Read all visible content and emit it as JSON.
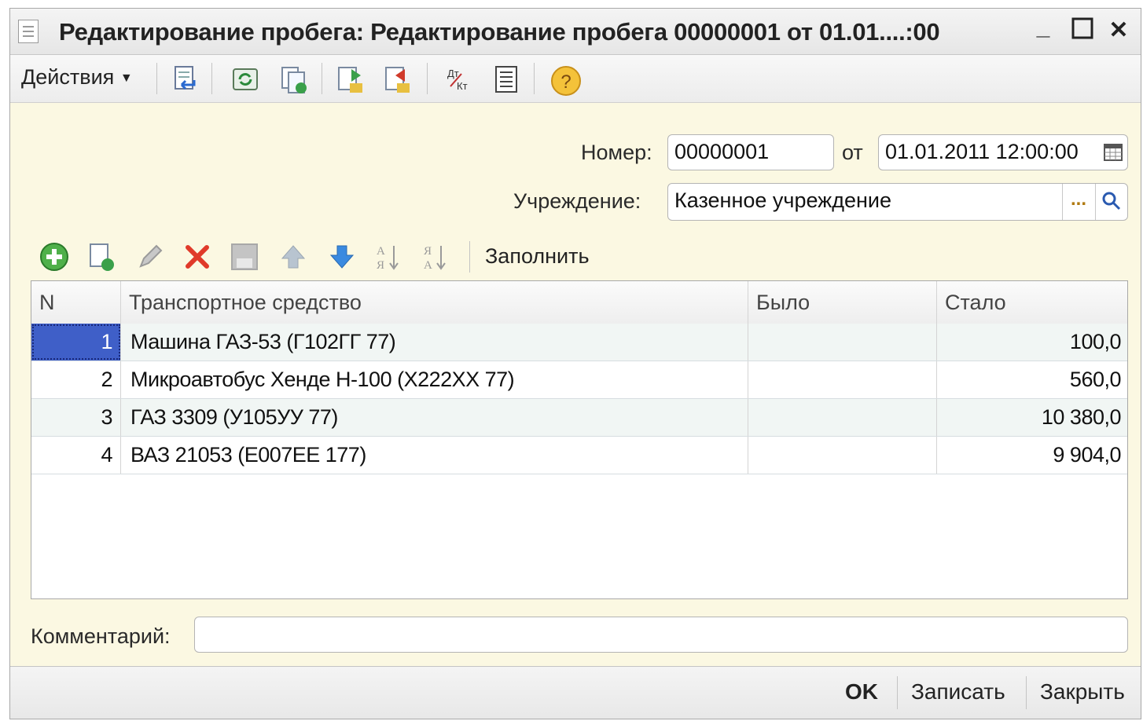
{
  "window": {
    "title": "Редактирование пробега: Редактирование пробега 00000001 от 01.01....:00",
    "minimize_glyph": "_",
    "maximize_glyph": "☐",
    "close_glyph": "✕"
  },
  "toolbar": {
    "actions_label": "Действия",
    "icons": [
      "post-and-close-icon",
      "refresh-icon",
      "copy-document-icon",
      "post-icon",
      "unpost-icon",
      "debit-credit-icon",
      "report-icon",
      "help-icon"
    ]
  },
  "form": {
    "number_label": "Номер:",
    "number_value": "00000001",
    "date_label": "от",
    "date_value": "01.01.2011 12:00:00",
    "institution_label": "Учреждение:",
    "institution_value": "Казенное учреждение",
    "comment_label": "Комментарий:",
    "comment_value": ""
  },
  "table_toolbar": {
    "fill_label": "Заполнить"
  },
  "table": {
    "columns": [
      "N",
      "Транспортное средство",
      "Было",
      "Стало"
    ],
    "rows": [
      {
        "n": "1",
        "vehicle": "Машина ГАЗ-53 (Г102ГГ 77)",
        "was": "",
        "became": "100,0"
      },
      {
        "n": "2",
        "vehicle": "Микроавтобус Хенде Н-100 (Х222ХХ 77)",
        "was": "",
        "became": "560,0"
      },
      {
        "n": "3",
        "vehicle": "ГАЗ 3309 (У105УУ 77)",
        "was": "",
        "became": "10 380,0"
      },
      {
        "n": "4",
        "vehicle": "ВАЗ 21053 (Е007ЕЕ 177)",
        "was": "",
        "became": "9 904,0"
      }
    ]
  },
  "footer": {
    "ok_label": "OK",
    "save_label": "Записать",
    "close_label": "Закрыть"
  },
  "colors": {
    "form_background": "#fbf8e2",
    "selection": "#3f5fc8",
    "alt_row": "#f1f6f4"
  }
}
